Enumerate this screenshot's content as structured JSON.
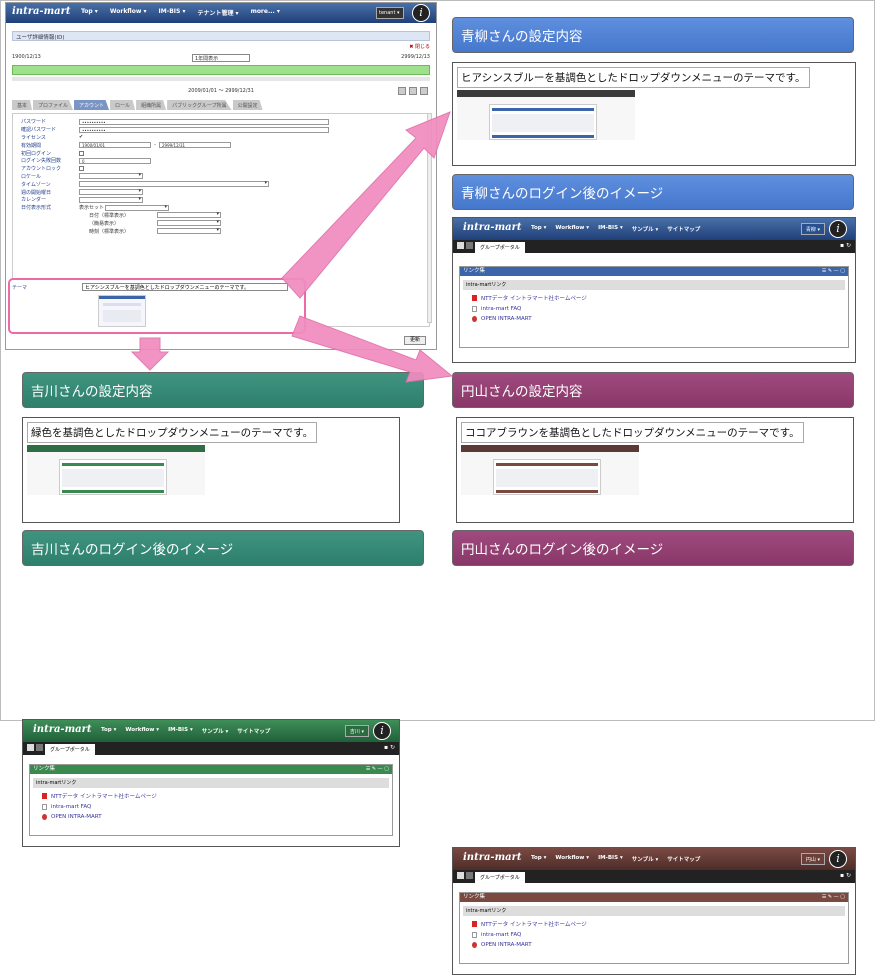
{
  "main_app": {
    "logo": "intra-mart",
    "nav": [
      "Top ▾",
      "Workflow ▾",
      "IM-BIS ▾",
      "テナント管理 ▾",
      "more... ▾"
    ],
    "user": "tenant ▾",
    "brand_glyph": "i",
    "title": "ユーザ詳細情報(ID)",
    "close_label": "閉じる",
    "date_left": "1900/12/13",
    "period_select": "1年間表示",
    "date_right": "2999/12/13",
    "range": "2009/01/01 ～ 2999/12/31",
    "tabs": [
      "基本",
      "プロファイル",
      "アカウント",
      "ロール",
      "組織所属",
      "パブリックグループ所属",
      "公開設定"
    ],
    "fields": {
      "password": "パスワード",
      "password_confirm": "確認パスワード",
      "license": "ライセンス",
      "valid_period": "有効期間",
      "valid_from": "1900/01/01",
      "valid_to": "2999/12/31",
      "first_login": "初回ログイン",
      "login_failures": "ログイン失敗回数",
      "login_failures_value": "0",
      "account_lock": "アカウントロック",
      "locale": "ロケール",
      "timezone": "タイムゾーン",
      "week_start": "週の開始曜日",
      "calendar": "カレンダー",
      "date_format": "日付表示形式",
      "display_set": "表示セット",
      "date_standard": "日付（標準表示）",
      "date_simple": "（簡易表示）",
      "time_standard": "時刻（標準表示）"
    },
    "theme_label": "テーマ",
    "theme_value": "ヒアシンスブルーを基調色としたドロップダウンメニューのテーマです。",
    "save_label": "更新"
  },
  "aoyagi": {
    "settings_title": "青柳さんの設定内容",
    "settings_desc": "ヒアシンスブルーを基調色としたドロップダウンメニューのテーマです。",
    "login_title": "青柳さんのログイン後のイメージ",
    "user": "青柳 ▾"
  },
  "yoshikawa": {
    "settings_title": "吉川さんの設定内容",
    "settings_desc": "緑色を基調色としたドロップダウンメニューのテーマです。",
    "login_title": "吉川さんのログイン後のイメージ",
    "user": "吉川 ▾"
  },
  "maruyama": {
    "settings_title": "円山さんの設定内容",
    "settings_desc": "ココアブラウンを基調色としたドロップダウンメニューのテーマです。",
    "login_title": "円山さんのログイン後のイメージ",
    "user": "円山 ▾"
  },
  "portal": {
    "logo": "intra-mart",
    "nav": [
      "Top ▾",
      "Workflow ▾",
      "IM-BIS ▾",
      "サンプル ▾",
      "サイトマップ"
    ],
    "tab": "グループポータル",
    "box_title": "リンク集",
    "box_sub": "intra-martリンク",
    "links": [
      "NTTデータ イントラマート社ホームページ",
      "intra-mart FAQ",
      "OPEN INTRA-MART"
    ]
  },
  "colors": {
    "blue": "#4577cc",
    "green": "#2e7f6c",
    "purple": "#883868",
    "arrow_pink": "#f08cc0"
  }
}
